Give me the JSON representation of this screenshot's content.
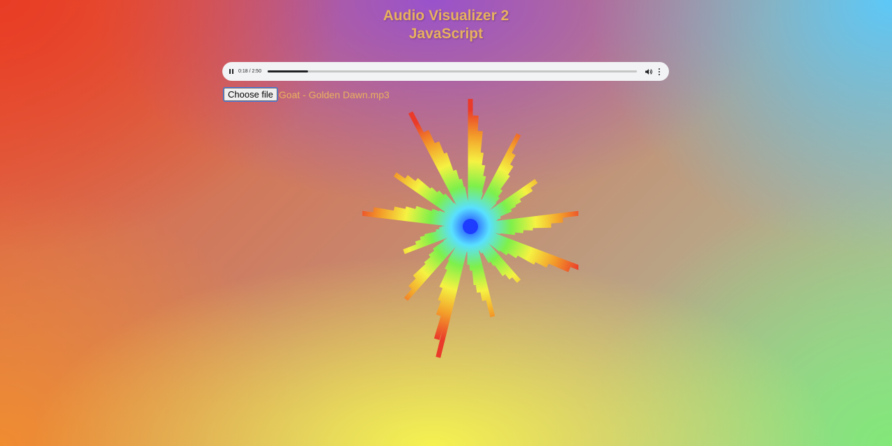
{
  "page": {
    "title_line1": "Audio Visualizer 2",
    "title_line2": "JavaScript"
  },
  "player": {
    "state": "playing",
    "time_label": "0:18 / 2:50",
    "progress_fraction": 0.11,
    "icons": {
      "play_pause": "pause-icon",
      "volume": "volume-icon",
      "menu": "more-vert-icon"
    }
  },
  "file_input": {
    "button_label": "Choose file",
    "file_name": "Goat - Golden Dawn.mp3"
  },
  "visualizer": {
    "type": "radial-frequency-bars",
    "spectrum": [
      0.95,
      0.72,
      0.55,
      0.78,
      0.88,
      0.5,
      0.62,
      0.98,
      0.7,
      0.45,
      0.8,
      0.66,
      0.92,
      0.52,
      0.74,
      0.6
    ],
    "colors": [
      "#1e3cff",
      "#59e0ff",
      "#7ef04a",
      "#f5f242",
      "#f3a02a",
      "#ea3a2a"
    ]
  },
  "colors": {
    "title": "#e8b15f",
    "file_name": "#e8b15f",
    "player_bg": "#f1f3f4"
  }
}
